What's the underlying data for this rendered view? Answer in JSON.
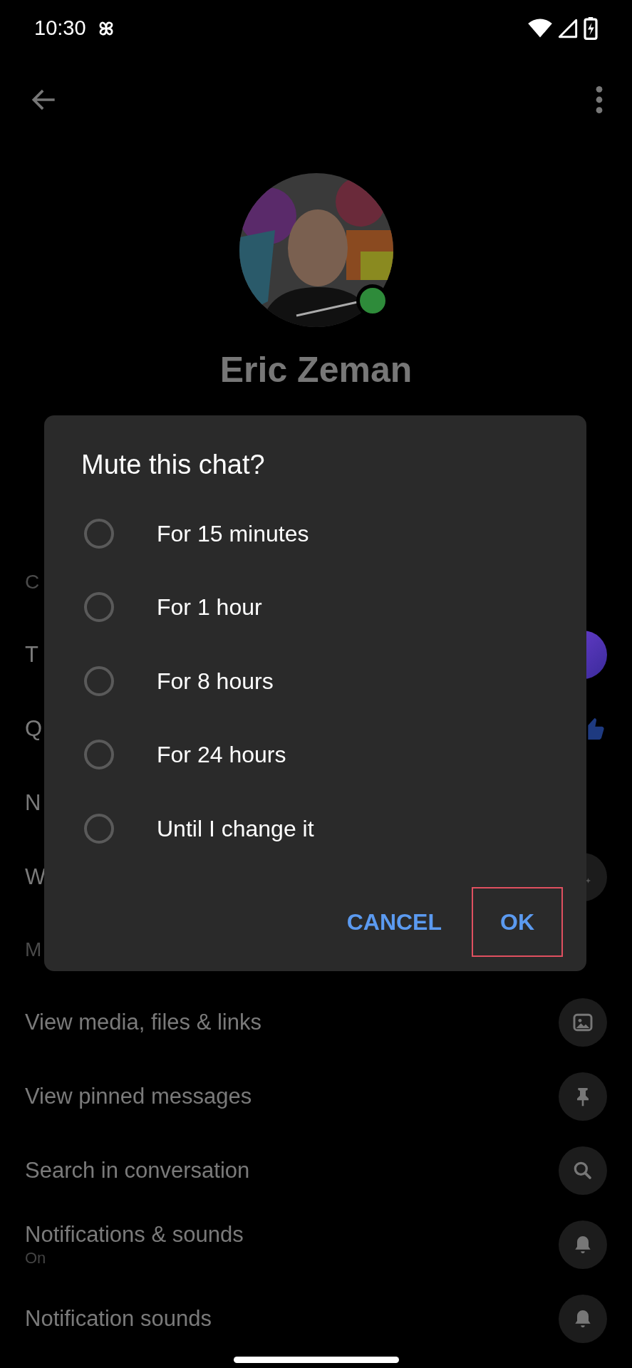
{
  "status_bar": {
    "time": "10:30"
  },
  "profile": {
    "name": "Eric Zeman",
    "online": true
  },
  "list": [
    {
      "kind": "header",
      "text": "C"
    },
    {
      "kind": "row",
      "text": "T"
    },
    {
      "kind": "row",
      "text": "Q"
    },
    {
      "kind": "row",
      "text": "N"
    },
    {
      "kind": "row",
      "text": "W"
    },
    {
      "kind": "header",
      "text": "M"
    },
    {
      "kind": "row",
      "text": "View media, files & links"
    },
    {
      "kind": "row",
      "text": "View pinned messages"
    },
    {
      "kind": "row",
      "text": "Search in conversation"
    },
    {
      "kind": "row",
      "text": "Notifications & sounds",
      "subtitle": "On"
    },
    {
      "kind": "row",
      "text": "Notification sounds"
    }
  ],
  "dialog": {
    "title": "Mute this chat?",
    "options": [
      {
        "label": "For 15 minutes",
        "selected": false
      },
      {
        "label": "For 1 hour",
        "selected": false
      },
      {
        "label": "For 8 hours",
        "selected": false
      },
      {
        "label": "For 24 hours",
        "selected": false
      },
      {
        "label": "Until I change it",
        "selected": false
      }
    ],
    "buttons": [
      {
        "label": "CANCEL",
        "highlighted": false
      },
      {
        "label": "OK",
        "highlighted": true
      }
    ]
  }
}
